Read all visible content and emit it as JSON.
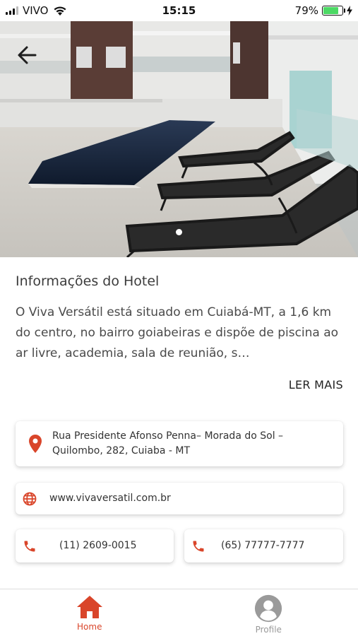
{
  "status_bar": {
    "carrier": "VIVO",
    "time": "15:15",
    "battery_percent": "79%",
    "battery_level": 0.79
  },
  "hero": {
    "icons": {
      "back": "arrow-left-icon"
    },
    "carousel_dots": 1,
    "active_dot": 0
  },
  "info": {
    "title": "Informações do Hotel",
    "description": "O Viva Versátil está situado em Cuiabá-MT, a 1,6 km do centro, no bairro goiabeiras e dispõe de piscina ao ar livre, academia, sala de reunião, s…",
    "read_more": "LER MAIS"
  },
  "contact": {
    "address": {
      "icon": "map-pin-icon",
      "line1": "Rua Presidente Afonso Penna– Morada do Sol –",
      "line2": "Quilombo, 282, Cuiaba - MT"
    },
    "website": {
      "icon": "globe-icon",
      "url": "www.vivaversatil.com.br"
    },
    "phones": [
      {
        "icon": "phone-icon",
        "number": "(11) 2609-0015"
      },
      {
        "icon": "phone-icon",
        "number": "(65) 77777-7777"
      }
    ]
  },
  "bottom_nav": {
    "items": [
      {
        "label": "Home",
        "icon": "home-icon",
        "active": true
      },
      {
        "label": "Profile",
        "icon": "user-circle-icon",
        "active": false
      }
    ]
  },
  "colors": {
    "accent": "#d9452a",
    "inactive": "#9a9a9a",
    "battery": "#4cd964"
  }
}
